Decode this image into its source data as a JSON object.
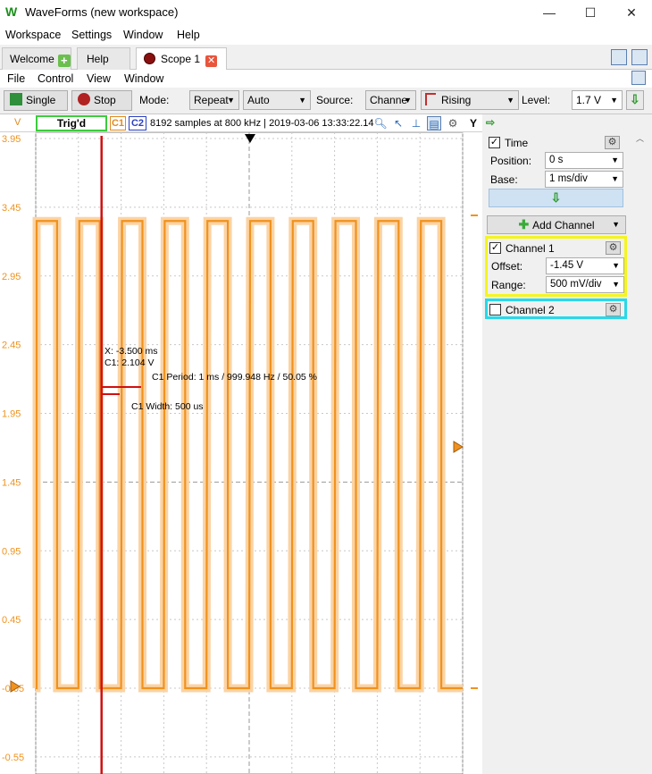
{
  "window": {
    "title": "WaveForms (new workspace)",
    "app_icon": "W"
  },
  "menu": [
    "Workspace",
    "Settings",
    "Window",
    "Help"
  ],
  "tabs": [
    {
      "label": "Welcome",
      "icon": "plus-icon"
    },
    {
      "label": "Help"
    },
    {
      "label": "Scope 1",
      "icon": "record-icon",
      "close": "✕"
    }
  ],
  "submenu": [
    "File",
    "Control",
    "View",
    "Window"
  ],
  "toolbar": {
    "single_label": "Single",
    "stop_label": "Stop",
    "mode_label": "Mode:",
    "mode_value": "Repeat",
    "auto_value": "Auto",
    "source_label": "Source:",
    "source_value": "Channe",
    "edge_value": "Rising",
    "level_label": "Level:",
    "level_value": "1.7 V"
  },
  "status": {
    "unit": "V",
    "trig": "Trig'd",
    "c1": "C1",
    "c2": "C2",
    "info": "8192 samples at 800 kHz | 2019-03-06 13:33:22.14",
    "y_button": "Y"
  },
  "side": {
    "time_label": "Time",
    "position_label": "Position:",
    "position_value": "0 s",
    "base_label": "Base:",
    "base_value": "1 ms/div",
    "add_channel": "Add Channel",
    "ch1_label": "Channel 1",
    "offset_label": "Offset:",
    "offset_value": "-1.45 V",
    "range_label": "Range:",
    "range_value": "500 mV/div",
    "ch2_label": "Channel 2"
  },
  "colors": {
    "channel1": "#f0921e",
    "channel1_light": "#fbd3a4",
    "cursor": "#d01010",
    "trig_border": "#3ccc3c",
    "ch1_panel": "#f5f51e",
    "ch2_panel": "#28d8e8"
  },
  "chart_data": {
    "type": "line",
    "y_unit": "V",
    "y_ticks": [
      "3.95",
      "3.45",
      "2.95",
      "2.45",
      "1.95",
      "1.45",
      "0.95",
      "0.45",
      "-0.05",
      "-0.55"
    ],
    "y_range": [
      -0.7,
      3.95
    ],
    "x_range_ms": [
      -5,
      5
    ],
    "series": [
      {
        "signal": "square",
        "high_v": 3.35,
        "low_v": -0.05,
        "period_ms": 1,
        "duty": 0.5,
        "first_rise_ms": -5,
        "color": "#f0921e"
      }
    ],
    "cursor": {
      "x_ms": -3.5
    },
    "annotations": {
      "cursor_x": "X: -3.500 ms",
      "cursor_c1": "C1: 2.104 V",
      "period": "C1 Period: 1 ms / 999.948 Hz / 50.05 %",
      "width": "C1 Width: 500 us"
    }
  }
}
